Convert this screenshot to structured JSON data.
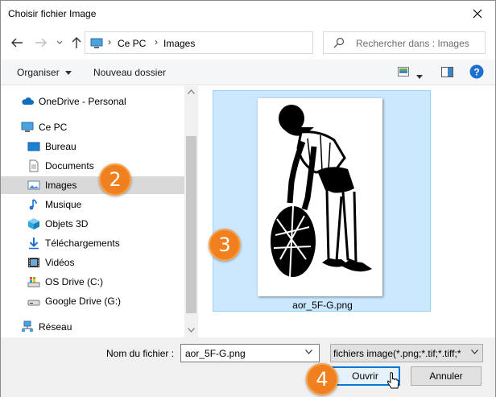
{
  "window": {
    "title": "Choisir fichier Image"
  },
  "address_bar": {
    "crumbs": [
      "Ce PC",
      "Images"
    ]
  },
  "search": {
    "placeholder": "Rechercher dans : Images"
  },
  "toolbar": {
    "organize_label": "Organiser",
    "new_folder_label": "Nouveau dossier"
  },
  "sidebar": {
    "items": [
      {
        "label": "OneDrive - Personal",
        "icon": "cloud-icon"
      },
      {
        "label": "Ce PC",
        "icon": "computer-icon"
      },
      {
        "label": "Bureau",
        "icon": "desktop-icon"
      },
      {
        "label": "Documents",
        "icon": "document-icon"
      },
      {
        "label": "Images",
        "icon": "pictures-icon",
        "selected": true
      },
      {
        "label": "Musique",
        "icon": "music-icon"
      },
      {
        "label": "Objets 3D",
        "icon": "cube-icon"
      },
      {
        "label": "Téléchargements",
        "icon": "download-icon"
      },
      {
        "label": "Vidéos",
        "icon": "video-icon"
      },
      {
        "label": "OS Drive (C:)",
        "icon": "drive-icon"
      },
      {
        "label": "Google Drive (G:)",
        "icon": "drive-icon"
      },
      {
        "label": "Réseau",
        "icon": "network-icon"
      }
    ]
  },
  "file_list": {
    "items": [
      {
        "name": "aor_5F-G.png",
        "selected": true
      }
    ]
  },
  "footer": {
    "filename_label": "Nom du fichier :",
    "filename_value": "aor_5F-G.png",
    "filter_value": "fichiers image(*.png;*.tif;*.tiff;*",
    "open_label": "Ouvrir",
    "cancel_label": "Annuler"
  },
  "annotations": {
    "badge_2": "2",
    "badge_3": "3",
    "badge_4": "4"
  },
  "colors": {
    "accent": "#0078d7",
    "selection": "#cce8ff",
    "badge": "#f07f1e"
  }
}
